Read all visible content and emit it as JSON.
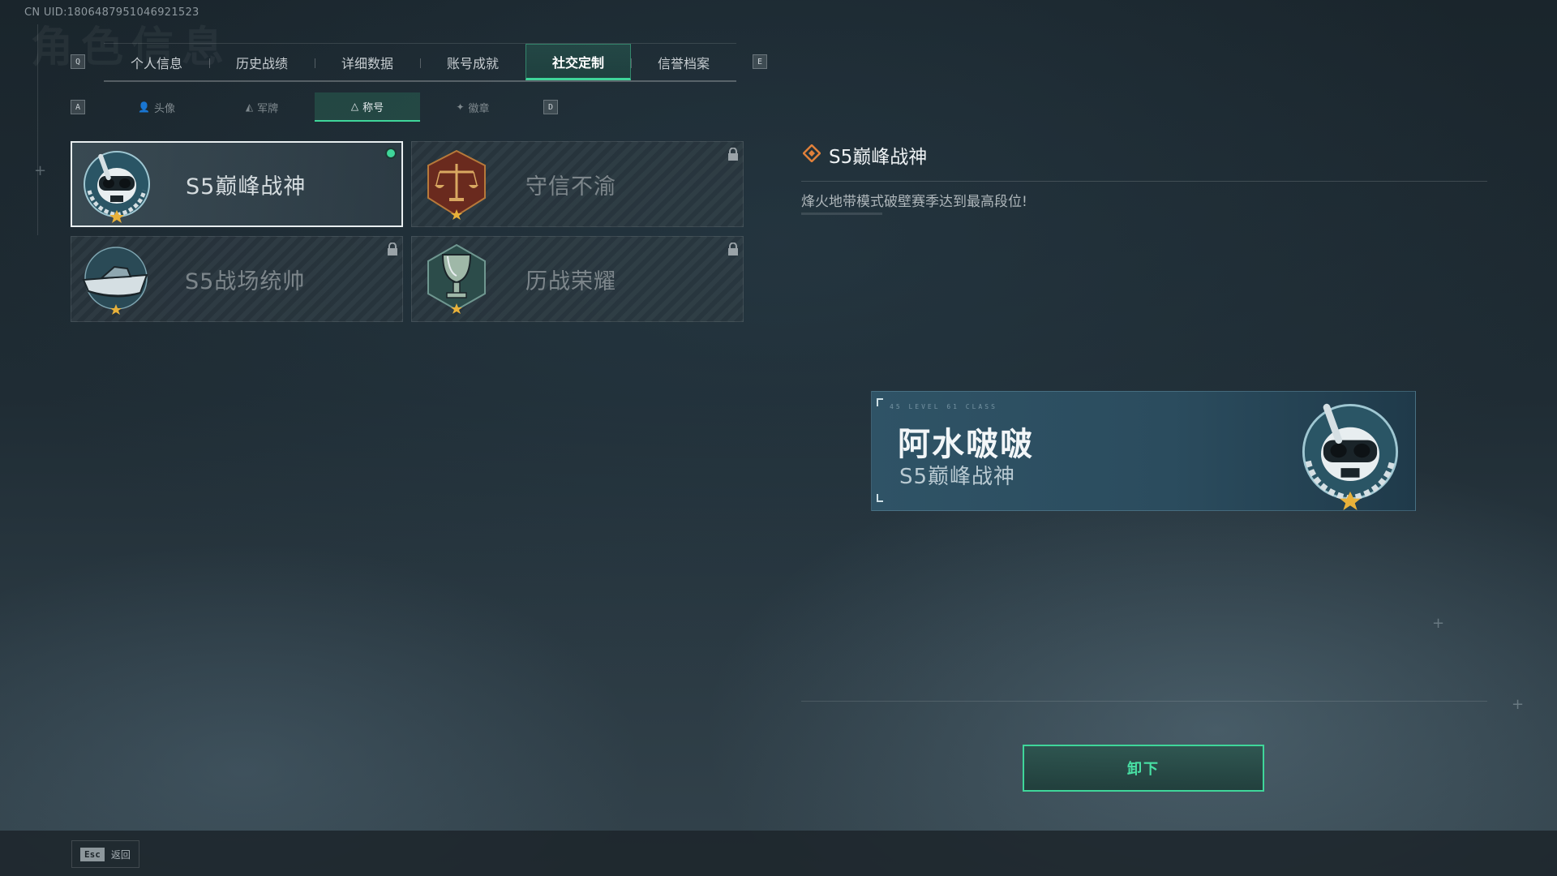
{
  "header": {
    "uid": "CN UID:1806487951046921523",
    "watermark": "角色信息"
  },
  "keys": {
    "tab_prev": "Q",
    "tab_next": "E",
    "sub_prev": "A",
    "sub_next": "D"
  },
  "tabs": [
    {
      "label": "个人信息"
    },
    {
      "label": "历史战绩"
    },
    {
      "label": "详细数据"
    },
    {
      "label": "账号成就"
    },
    {
      "label": "社交定制",
      "active": true
    },
    {
      "label": "信誉档案"
    }
  ],
  "subtabs": [
    {
      "label": "头像",
      "icon": "person-icon"
    },
    {
      "label": "军牌",
      "icon": "dogtag-icon"
    },
    {
      "label": "称号",
      "icon": "triangle-icon",
      "active": true
    },
    {
      "label": "徽章",
      "icon": "badge-icon"
    }
  ],
  "titles": [
    {
      "label": "S5巅峰战神",
      "emblem": "diver-skull-emblem",
      "selected": true,
      "equipped": true,
      "locked": false
    },
    {
      "label": "守信不渝",
      "emblem": "scales-emblem",
      "selected": false,
      "equipped": false,
      "locked": true
    },
    {
      "label": "S5战场统帅",
      "emblem": "speedboat-emblem",
      "selected": false,
      "equipped": false,
      "locked": true
    },
    {
      "label": "历战荣耀",
      "emblem": "trophy-emblem",
      "selected": false,
      "equipped": false,
      "locked": true
    }
  ],
  "detail": {
    "title": "S5巅峰战神",
    "description": "烽火地带模式破壁赛季达到最高段位!"
  },
  "preview": {
    "codes": "45 LEVEL  61 CLASS",
    "player_name": "阿水啵啵",
    "title": "S5巅峰战神"
  },
  "actions": {
    "unequip_label": "卸下"
  },
  "footer": {
    "esc_key": "Esc",
    "back_label": "返回"
  },
  "colors": {
    "accent": "#3fd69a",
    "detail_diamond": "#e0803a",
    "star": "#e8b13a"
  }
}
